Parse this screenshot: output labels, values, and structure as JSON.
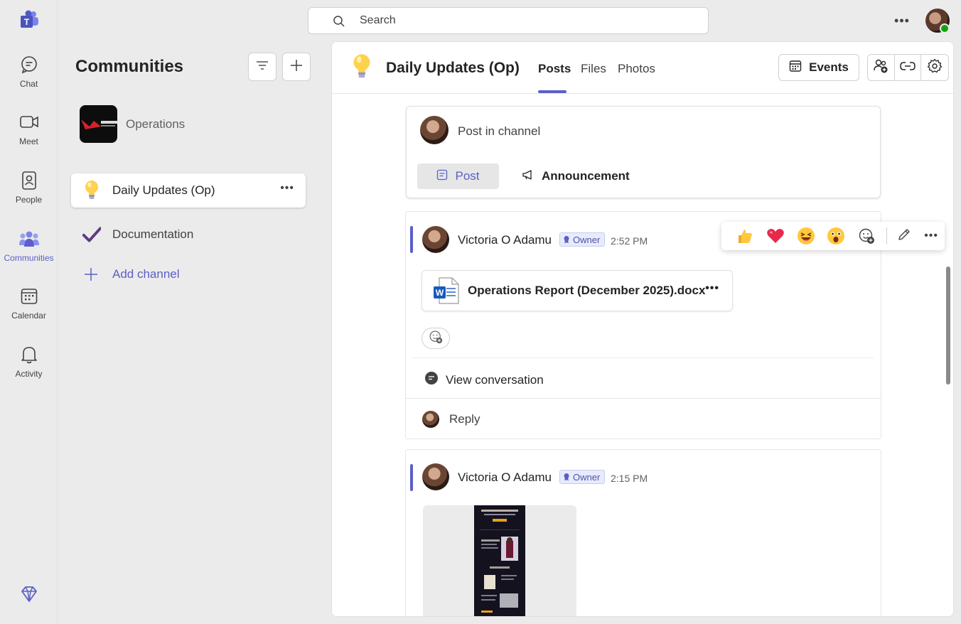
{
  "rail": {
    "items": [
      {
        "label": "Chat",
        "icon": "chat-icon"
      },
      {
        "label": "Meet",
        "icon": "video-icon"
      },
      {
        "label": "People",
        "icon": "contact-book-icon"
      },
      {
        "label": "Communities",
        "icon": "communities-icon",
        "active": true
      },
      {
        "label": "Calendar",
        "icon": "calendar-icon"
      },
      {
        "label": "Activity",
        "icon": "bell-icon"
      }
    ]
  },
  "search": {
    "placeholder": "Search"
  },
  "panel": {
    "title": "Communities",
    "team_name": "Operations",
    "channels": [
      {
        "label": "Daily Updates (Op)",
        "active": true
      },
      {
        "label": "Documentation"
      }
    ],
    "add_channel": "Add channel"
  },
  "header": {
    "channel_title": "Daily Updates (Op)",
    "tabs": [
      "Posts",
      "Files",
      "Photos"
    ],
    "events_label": "Events"
  },
  "composer": {
    "placeholder": "Post in channel",
    "post_label": "Post",
    "announcement_label": "Announcement"
  },
  "posts": [
    {
      "author": "Victoria O Adamu",
      "badge": "Owner",
      "time": "2:52 PM",
      "file_name": "Operations Report (December 2025).docx",
      "view_conversation": "View conversation",
      "reply": "Reply"
    },
    {
      "author": "Victoria O Adamu",
      "badge": "Owner",
      "time": "2:15 PM"
    }
  ],
  "colors": {
    "accent": "#5b5fc7",
    "status_online": "#13a10e"
  }
}
